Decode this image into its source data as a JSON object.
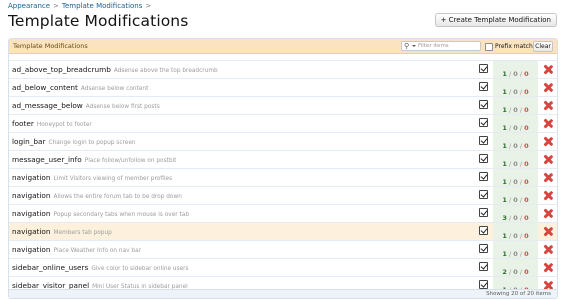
{
  "breadcrumb": {
    "items": [
      "Appearance",
      "Template Modifications"
    ],
    "separator": ">"
  },
  "page": {
    "title": "Template Modifications"
  },
  "toolbar": {
    "create_label": "+ Create Template Modification"
  },
  "list": {
    "header_title": "Template Modifications",
    "filter_placeholder": "Filter items",
    "prefix_match_label": "Prefix match",
    "clear_label": "Clear",
    "rows": [
      {
        "title": "ad_above_top_breadcrumb",
        "desc": "Adsense above the top breadcrumb",
        "counts": [
          "1",
          "0",
          "0"
        ],
        "active": true
      },
      {
        "title": "ad_below_content",
        "desc": "Adsense below content",
        "counts": [
          "1",
          "0",
          "0"
        ],
        "active": true
      },
      {
        "title": "ad_message_below",
        "desc": "Adsense below first posts",
        "counts": [
          "1",
          "0",
          "0"
        ],
        "active": true
      },
      {
        "title": "footer",
        "desc": "Honeypot to footer",
        "counts": [
          "1",
          "0",
          "0"
        ],
        "active": true
      },
      {
        "title": "login_bar",
        "desc": "Change login to popup screen",
        "counts": [
          "1",
          "0",
          "0"
        ],
        "active": true
      },
      {
        "title": "message_user_info",
        "desc": "Place follow/unfollow on postbit",
        "counts": [
          "1",
          "0",
          "0"
        ],
        "active": true
      },
      {
        "title": "navigation",
        "desc": "Limit Visitors viewing of member profiles",
        "counts": [
          "1",
          "0",
          "0"
        ],
        "active": true
      },
      {
        "title": "navigation",
        "desc": "Allows the entire forum tab to be drop down",
        "counts": [
          "1",
          "0",
          "0"
        ],
        "active": true
      },
      {
        "title": "navigation",
        "desc": "Popup secondary tabs when mouse is over tab",
        "counts": [
          "3",
          "0",
          "0"
        ],
        "active": true
      },
      {
        "title": "navigation",
        "desc": "Members tab popup",
        "counts": [
          "1",
          "0",
          "0"
        ],
        "active": true
      },
      {
        "title": "navigation",
        "desc": "Place Weather Info on nav bar",
        "counts": [
          "1",
          "0",
          "0"
        ],
        "active": true
      },
      {
        "title": "sidebar_online_users",
        "desc": "Give color to sidebar online users",
        "counts": [
          "2",
          "0",
          "0"
        ],
        "active": true
      },
      {
        "title": "sidebar_visitor_panel",
        "desc": "Mini User Status in sidebar panel",
        "counts": [
          "1",
          "0",
          "0"
        ],
        "active": true
      }
    ],
    "footer_text": "Showing 20 of 20 items"
  },
  "colors": {
    "header_bg": "#fbe3bf",
    "link_blue": "#176093",
    "count_green": "#2d6f2d",
    "delete_red": "#d8453e",
    "highlight_row": "#fdf1de"
  },
  "icons": [
    "search-icon",
    "checkbox-icon",
    "delete-icon"
  ]
}
